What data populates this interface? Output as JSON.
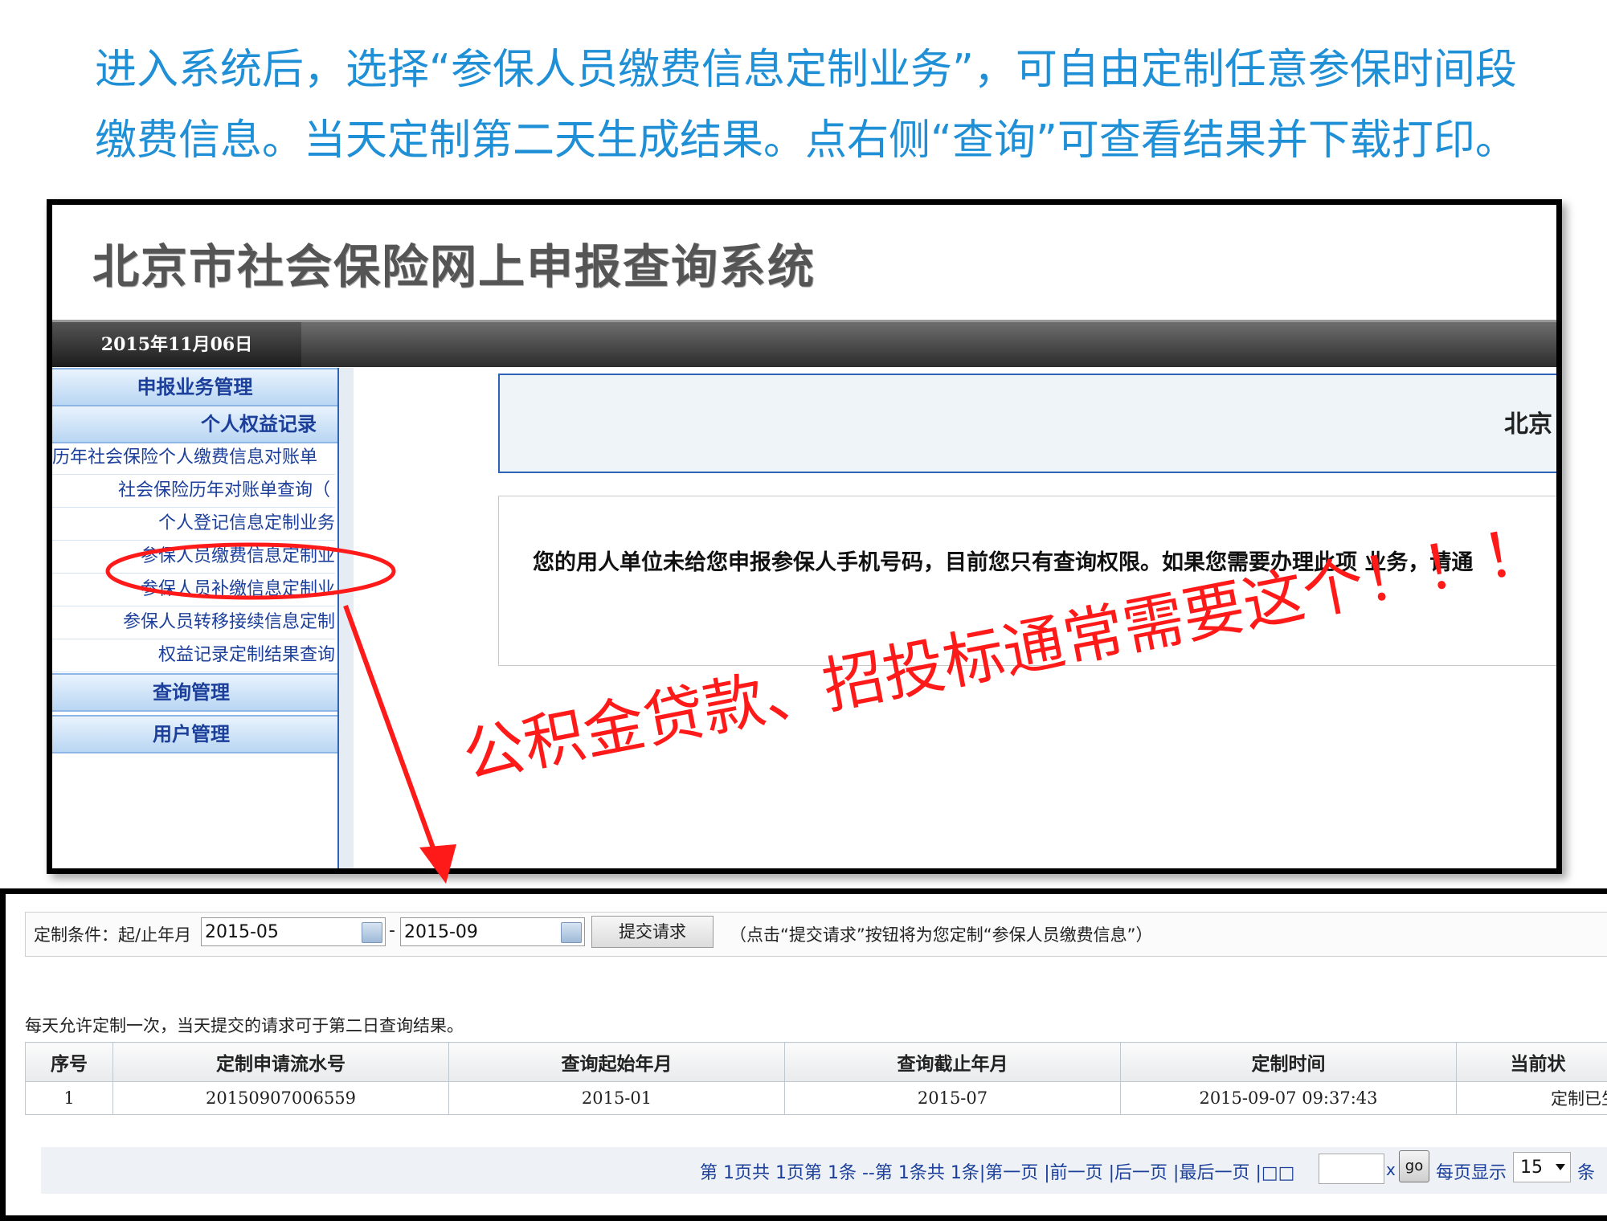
{
  "instructions": {
    "line1": "进入系统后，选择“参保人员缴费信息定制业务”，可自由定制任意参保时间段",
    "line2": "缴费信息。当天定制第二天生成结果。点右侧“查询”可查看结果并下载打印。"
  },
  "system": {
    "title": "北京市社会保险网上申报查询系统",
    "date": "2015年11月06日"
  },
  "sidebar": {
    "sections": [
      {
        "label": "申报业务管理"
      },
      {
        "label": "个人权益记录"
      },
      {
        "label": "查询管理"
      },
      {
        "label": "用户管理"
      }
    ],
    "items": [
      {
        "label": "历年社会保险个人缴费信息对账单"
      },
      {
        "label": "社会保险历年对账单查询（"
      },
      {
        "label": "个人登记信息定制业务"
      },
      {
        "label": "参保人员缴费信息定制业"
      },
      {
        "label": "参保人员补缴信息定制业"
      },
      {
        "label": "参保人员转移接续信息定制"
      },
      {
        "label": "权益记录定制结果查询"
      }
    ]
  },
  "main": {
    "welcome": "北京",
    "notice": "您的用人单位未给您申报参保人手机号码，目前您只有查询权限。如果您需要办理此项 业务，请通"
  },
  "annotation": {
    "text": "公积金贷款、招投标通常需要这个！！！",
    "color": "#ff1a1a"
  },
  "customize": {
    "label": "定制条件：起/止年月",
    "from": "2015-05",
    "separator": "-",
    "to": "2015-09",
    "submit": "提交请求",
    "hint": "（点击“提交请求”按钮将为您定制“参保人员缴费信息”）",
    "rule": "每天允许定制一次，当天提交的请求可于第二日查询结果。"
  },
  "table": {
    "headers": [
      "序号",
      "定制申请流水号",
      "查询起始年月",
      "查询截止年月",
      "定制时间",
      "当前状"
    ],
    "rows": [
      [
        "1",
        "20150907006559",
        "2015-01",
        "2015-07",
        "2015-09-07 09:37:43",
        "定制已生"
      ]
    ]
  },
  "pager": {
    "text": "第 1页共 1页第 1条 --第 1条共 1条|第一页 |前一页 |后一页 |最后一页 |□□",
    "go": "go",
    "x": "x",
    "per_page_label": "每页显示",
    "per_page": "15",
    "unit": "条"
  },
  "colors": {
    "instruction": "#1f8fd6",
    "link": "#1b3f9a",
    "highlight": "#ff1a1a"
  }
}
